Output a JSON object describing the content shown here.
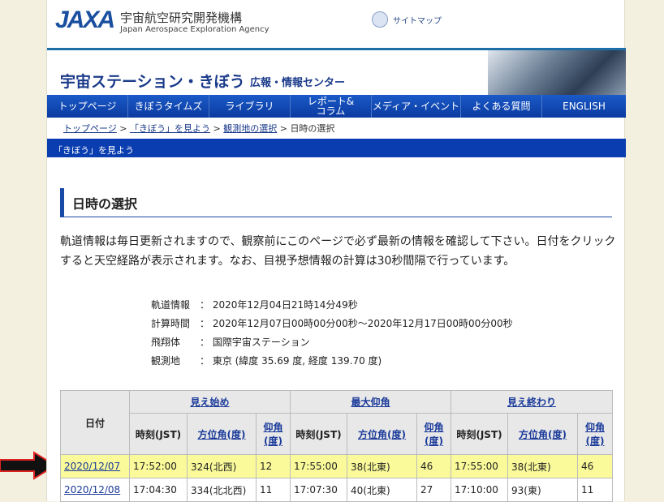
{
  "header": {
    "logo": "JAXA",
    "org_jp": "宇宙航空研究開発機構",
    "org_en": "Japan Aerospace Exploration Agency",
    "sitemap": "サイトマップ"
  },
  "banner": {
    "title": "宇宙ステーション・きぼう",
    "subtitle": "広報・情報センター"
  },
  "nav": [
    "トップページ",
    "きぼうタイムズ",
    "ライブラリ",
    "レポート&コラム",
    "メディア・イベント",
    "よくある質問",
    "ENGLISH"
  ],
  "breadcrumb": {
    "items": [
      "トップページ",
      "「きぼう」を見よう",
      "観測地の選択"
    ],
    "current": "日時の選択",
    "sep": " > "
  },
  "section_bar": "「きぼう」を見よう",
  "heading": "日時の選択",
  "intro": "軌道情報は毎日更新されますので、観察前にこのページで必ず最新の情報を確認して下さい。日付をクリックすると天空経路が表示されます。なお、目視予想情報の計算は30秒間隔で行っています。",
  "info": [
    {
      "k": "軌道情報",
      "v": "：  2020年12月04日21時14分49秒"
    },
    {
      "k": "計算時間",
      "v": "：  2020年12月07日00時00分00秒～2020年12月17日00時00分00秒"
    },
    {
      "k": "飛翔体",
      "v": "：  国際宇宙ステーション"
    },
    {
      "k": "観測地",
      "v": "：  東京 (緯度 35.69 度, 経度 139.70 度)"
    }
  ],
  "table": {
    "date_header": "日付",
    "groups": [
      "見え始め",
      "最大仰角",
      "見え終わり"
    ],
    "sub": {
      "time": "時刻(JST)",
      "az": "方位角(度)",
      "el": "仰角(度)"
    },
    "rows": [
      [
        "2020/12/07",
        "17:52:00",
        "324(北西)",
        "12",
        "17:55:00",
        "38(北東)",
        "46",
        "17:55:00",
        "38(北東)",
        "46"
      ],
      [
        "2020/12/08",
        "17:04:30",
        "334(北北西)",
        "11",
        "17:07:30",
        "40(北東)",
        "27",
        "17:10:00",
        "93(東)",
        "11"
      ]
    ]
  }
}
